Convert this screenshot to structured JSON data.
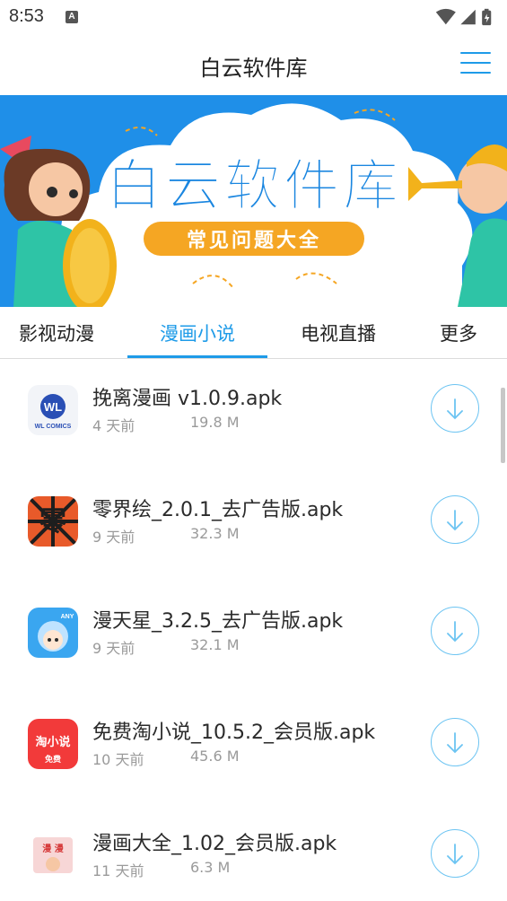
{
  "status_bar": {
    "time": "8:53",
    "notification_badge": "A",
    "icons": [
      "wifi-icon",
      "signal-icon",
      "battery-icon"
    ]
  },
  "header": {
    "title": "白云软件库",
    "menu_icon": "hamburger-menu-icon"
  },
  "banner": {
    "title": "白云软件库",
    "subtitle": "常见问题大全"
  },
  "tabs": [
    {
      "label": "影视动漫",
      "active": false
    },
    {
      "label": "漫画小说",
      "active": true
    },
    {
      "label": "电视直播",
      "active": false
    },
    {
      "label": "更多",
      "active": false
    }
  ],
  "items": [
    {
      "name": "挽离漫画 v1.0.9.apk",
      "date": "4 天前",
      "size": "19.8 M",
      "icon": "wl-comics-app-icon"
    },
    {
      "name": "零界绘_2.0.1_去广告版.apk",
      "date": "9 天前",
      "size": "32.3 M",
      "icon": "lingjiehui-app-icon"
    },
    {
      "name": "漫天星_3.2.5_去广告版.apk",
      "date": "9 天前",
      "size": "32.1 M",
      "icon": "mantianxing-app-icon"
    },
    {
      "name": "免费淘小说_10.5.2_会员版.apk",
      "date": "10 天前",
      "size": "45.6 M",
      "icon": "taoxiaoshuo-app-icon"
    },
    {
      "name": "漫画大全_1.02_会员版.apk",
      "date": "11 天前",
      "size": "6.3 M",
      "icon": "manhuadaquan-app-icon"
    }
  ],
  "icon_texts": {
    "wl": "WL",
    "wl_sub": "WL COMICS",
    "ling": "零",
    "any": "ANY",
    "tao": "淘小说",
    "tao_sub": "免费",
    "mh": "漫 漫"
  },
  "colors": {
    "accent": "#1e9be8",
    "banner_bg": "#1f8fe8",
    "banner_title": "#1a86e0",
    "banner_pill": "#f5a623"
  }
}
